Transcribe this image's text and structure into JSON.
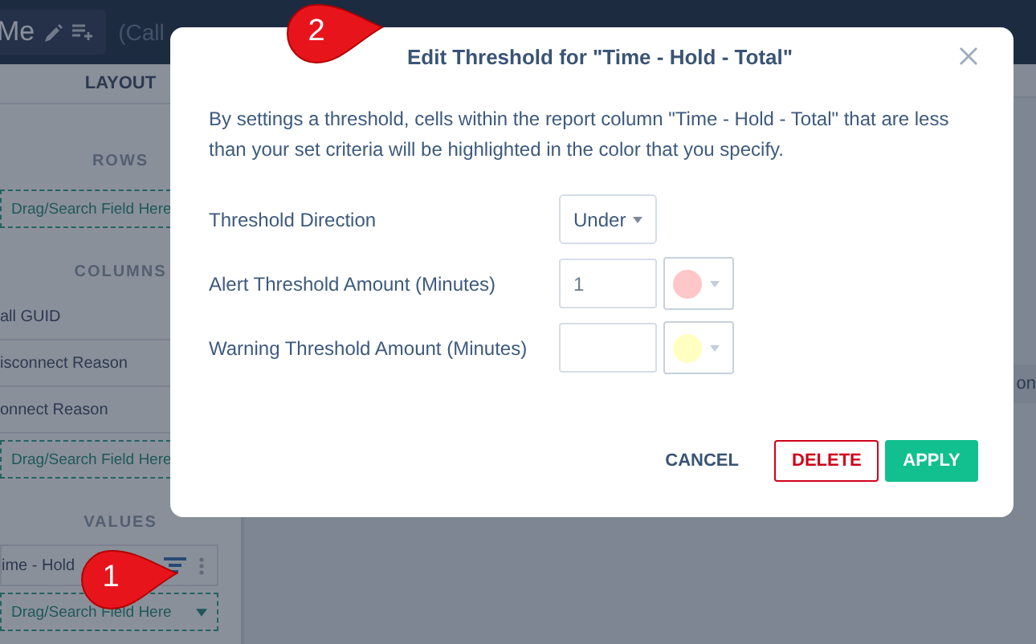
{
  "header": {
    "title": "Me",
    "tab_hint": "(Call"
  },
  "layout_panel": {
    "title": "LAYOUT",
    "sections": [
      {
        "title": "ROWS",
        "kind": "plain",
        "drop_hint": "Drag/Search Field Here"
      },
      {
        "title": "COLUMNS",
        "kind": "plain",
        "fields": [
          "all GUID",
          "isconnect Reason",
          "onnect Reason"
        ],
        "drop_hint": "Drag/Search Field Here"
      },
      {
        "title": "VALUES",
        "kind": "values",
        "fields": [
          "ime - Hold"
        ],
        "drop_hint": "Drag/Search Field Here"
      }
    ]
  },
  "main": {
    "column_text": "on"
  },
  "dialog": {
    "title": "Edit Threshold for \"Time - Hold - Total\"",
    "description": "By settings a threshold, cells within the report column \"Time - Hold - Total\" that are less than your set criteria will be highlighted in the color that you specify.",
    "rows": [
      {
        "kind": "select",
        "label": "Threshold Direction",
        "value": "Under"
      },
      {
        "kind": "amount",
        "label": "Alert Threshold Amount (Minutes)",
        "value": "1",
        "color": "#ffc7c7"
      },
      {
        "kind": "amount",
        "label": "Warning Threshold Amount (Minutes)",
        "color": "#ffffc2"
      }
    ],
    "buttons": [
      {
        "kind": "text",
        "label": "CANCEL"
      },
      {
        "kind": "outline",
        "label": "DELETE"
      },
      {
        "kind": "primary",
        "label": "APPLY"
      }
    ]
  },
  "callouts": [
    {
      "number": "1"
    },
    {
      "number": "2"
    }
  ]
}
